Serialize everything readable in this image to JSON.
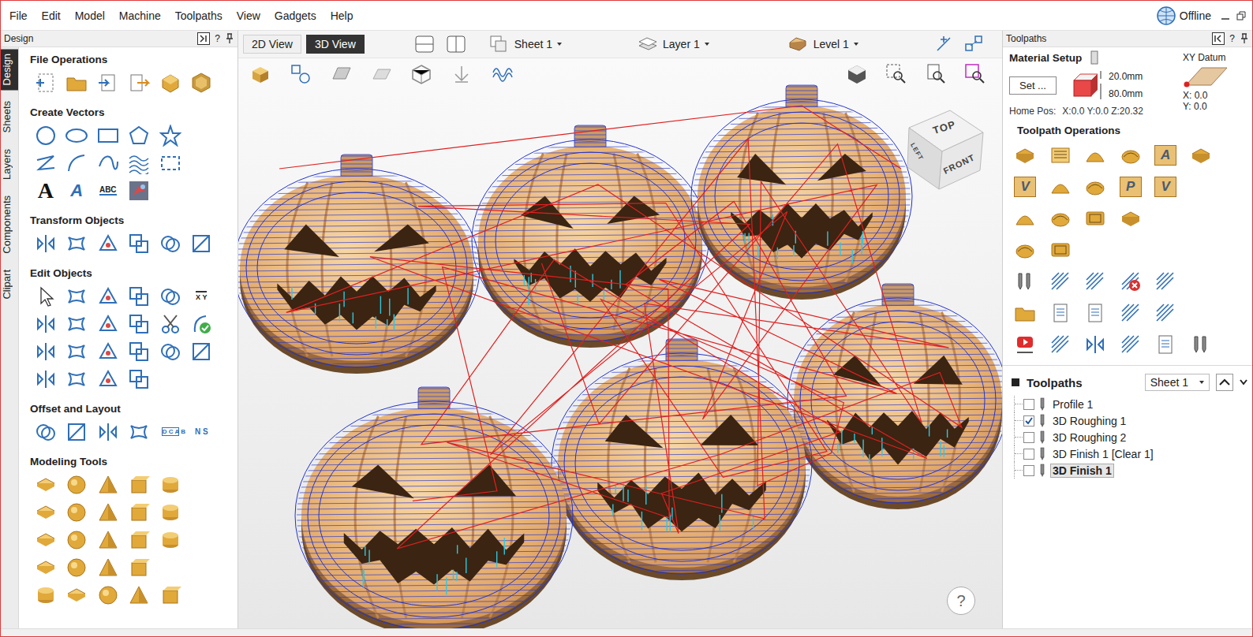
{
  "menu": [
    "File",
    "Edit",
    "Model",
    "Machine",
    "Toolpaths",
    "View",
    "Gadgets",
    "Help"
  ],
  "connection": {
    "label": "Offline"
  },
  "design_panel": {
    "title": "Design",
    "help": "?",
    "vertical_tabs": [
      {
        "label": "Design",
        "selected": true
      },
      {
        "label": "Sheets",
        "selected": false
      },
      {
        "label": "Layers",
        "selected": false
      },
      {
        "label": "Components",
        "selected": false
      },
      {
        "label": "Clipart",
        "selected": false
      }
    ],
    "sections": [
      {
        "title": "File Operations",
        "text_icons": []
      },
      {
        "title": "Create Vectors",
        "text_icons": [
          "A",
          "A",
          "ABC"
        ]
      },
      {
        "title": "Transform Objects",
        "text_icons": []
      },
      {
        "title": "Edit Objects",
        "text_icons": [
          "X Y"
        ]
      },
      {
        "title": "Offset and Layout",
        "text_icons": [
          "D C A B",
          "N S"
        ]
      },
      {
        "title": "Modeling Tools",
        "text_icons": []
      }
    ]
  },
  "view": {
    "tabs": [
      {
        "label": "2D View",
        "selected": false
      },
      {
        "label": "3D View",
        "selected": true
      }
    ],
    "dropdowns": [
      "Sheet 1",
      "Layer 1",
      "Level 1"
    ],
    "cube": [
      "TOP",
      "LEFT",
      "FRONT"
    ],
    "help": "?"
  },
  "toolpaths_panel": {
    "title": "Toolpaths",
    "help": "?",
    "material": {
      "title": "Material Setup",
      "button": "Set ...",
      "thickness": "20.0mm",
      "offset": "80.0mm",
      "home_label": "Home Pos:",
      "home_value": "X:0.0 Y:0.0 Z:20.32",
      "datum_title": "XY Datum",
      "datum_x": "X: 0.0",
      "datum_y": "Y: 0.0"
    },
    "operations_title": "Toolpath Operations",
    "operation_text_icons": [
      "A",
      "V",
      "P",
      "V"
    ],
    "list_title": "Toolpaths",
    "sheet": "Sheet 1",
    "items": [
      {
        "label": "Profile 1",
        "checked": false,
        "selected": false
      },
      {
        "label": "3D Roughing 1",
        "checked": true,
        "selected": false
      },
      {
        "label": "3D Roughing 2",
        "checked": false,
        "selected": false
      },
      {
        "label": "3D Finish 1 [Clear 1]",
        "checked": false,
        "selected": false
      },
      {
        "label": "3D Finish 1",
        "checked": false,
        "selected": true
      }
    ]
  }
}
